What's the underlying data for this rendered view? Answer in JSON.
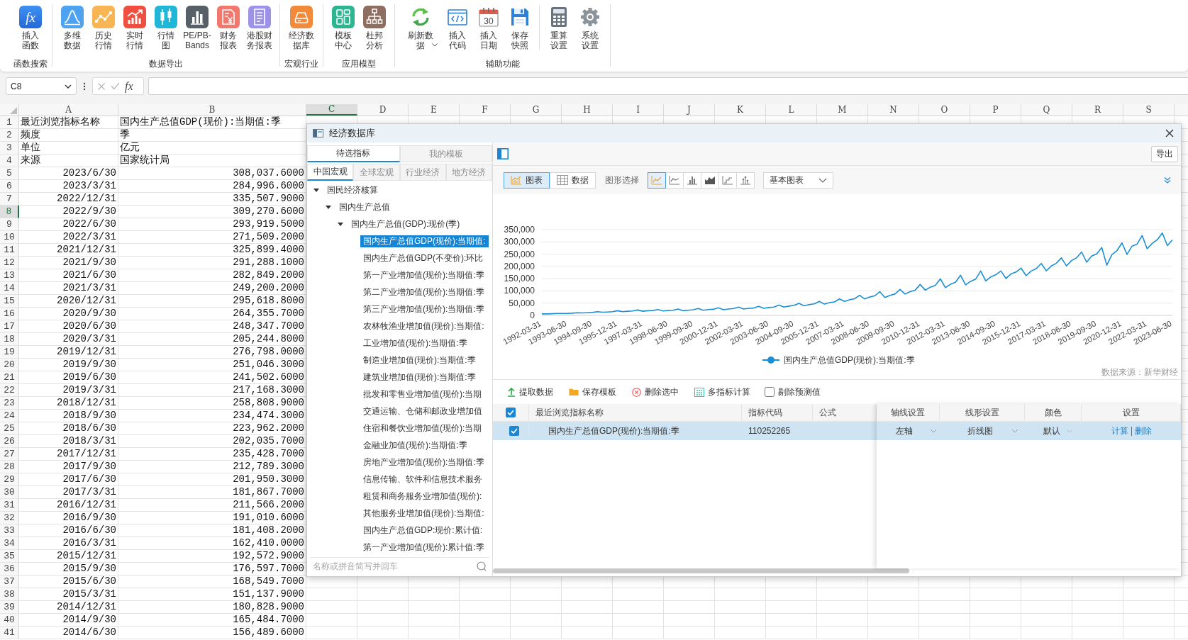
{
  "ribbon": {
    "groups": [
      {
        "label": "函数搜索",
        "sections": [
          [
            {
              "label": "插入函数",
              "glyph": "fx",
              "dropdown": false
            }
          ]
        ]
      },
      {
        "label": "数据导出",
        "sections": [
          [
            {
              "label": "多维数据",
              "dropdown": false
            },
            {
              "label": "历史行情",
              "dropdown": false
            },
            {
              "label": "实时行情",
              "dropdown": false
            },
            {
              "label": "行情图",
              "dropdown": false
            },
            {
              "label": "PE/PB-Bands",
              "dropdown": false
            },
            {
              "label": "财务报表",
              "dropdown": false
            },
            {
              "label": "港股财务报表",
              "dropdown": false
            }
          ]
        ]
      },
      {
        "label": "宏观行业",
        "sections": [
          [
            {
              "label": "经济数据库",
              "dropdown": false
            }
          ]
        ]
      },
      {
        "label": "应用模型",
        "sections": [
          [
            {
              "label": "模板中心",
              "dropdown": false
            },
            {
              "label": "杜邦分析",
              "dropdown": false
            }
          ]
        ]
      },
      {
        "label": "辅助功能",
        "sections": [
          [
            {
              "label": "刷新数据",
              "dropdown": true
            },
            {
              "label": "插入代码",
              "dropdown": false
            },
            {
              "label": "插入日期",
              "glyph": "30",
              "dropdown": false
            },
            {
              "label": "保存快照",
              "dropdown": false
            }
          ],
          [
            {
              "label": "重算设置",
              "dropdown": false
            },
            {
              "label": "系统设置",
              "dropdown": false
            }
          ]
        ]
      }
    ]
  },
  "formula_bar": {
    "name_box": "C8",
    "function_glyph": "fx"
  },
  "sheet": {
    "columns": [
      {
        "label": "A",
        "selected": false
      },
      {
        "label": "B",
        "selected": false
      },
      {
        "label": "C",
        "selected": true
      },
      {
        "label": "D",
        "selected": false
      },
      {
        "label": "E",
        "selected": false
      },
      {
        "label": "F",
        "selected": false
      },
      {
        "label": "G",
        "selected": false
      },
      {
        "label": "H",
        "selected": false
      },
      {
        "label": "I",
        "selected": false
      },
      {
        "label": "J",
        "selected": false
      },
      {
        "label": "K",
        "selected": false
      },
      {
        "label": "L",
        "selected": false
      },
      {
        "label": "M",
        "selected": false
      },
      {
        "label": "N",
        "selected": false
      },
      {
        "label": "O",
        "selected": false
      },
      {
        "label": "P",
        "selected": false
      },
      {
        "label": "Q",
        "selected": false
      },
      {
        "label": "R",
        "selected": false
      },
      {
        "label": "S",
        "selected": false
      }
    ],
    "rows": [
      {
        "header": "1",
        "selected": false,
        "kind": "label",
        "cells": [
          "最近浏览指标名称",
          "国内生产总值GDP(现价):当期值:季"
        ]
      },
      {
        "header": "2",
        "selected": false,
        "kind": "label",
        "cells": [
          "频度",
          "季"
        ]
      },
      {
        "header": "3",
        "selected": false,
        "kind": "label",
        "cells": [
          "单位",
          "亿元"
        ]
      },
      {
        "header": "4",
        "selected": false,
        "kind": "label",
        "cells": [
          "来源",
          "国家统计局"
        ]
      },
      {
        "header": "5",
        "selected": false,
        "kind": "value",
        "cells": [
          "2023/6/30",
          "308,037.6000"
        ]
      },
      {
        "header": "6",
        "selected": false,
        "kind": "value",
        "cells": [
          "2023/3/31",
          "284,996.6000"
        ]
      },
      {
        "header": "7",
        "selected": false,
        "kind": "value",
        "cells": [
          "2022/12/31",
          "335,507.9000"
        ]
      },
      {
        "header": "8",
        "selected": true,
        "kind": "value",
        "cells": [
          "2022/9/30",
          "309,270.6000"
        ]
      },
      {
        "header": "9",
        "selected": false,
        "kind": "value",
        "cells": [
          "2022/6/30",
          "293,919.5000"
        ]
      },
      {
        "header": "10",
        "selected": false,
        "kind": "value",
        "cells": [
          "2022/3/31",
          "271,509.2000"
        ]
      },
      {
        "header": "11",
        "selected": false,
        "kind": "value",
        "cells": [
          "2021/12/31",
          "325,899.4000"
        ]
      },
      {
        "header": "12",
        "selected": false,
        "kind": "value",
        "cells": [
          "2021/9/30",
          "291,288.1000"
        ]
      },
      {
        "header": "13",
        "selected": false,
        "kind": "value",
        "cells": [
          "2021/6/30",
          "282,849.2000"
        ]
      },
      {
        "header": "14",
        "selected": false,
        "kind": "value",
        "cells": [
          "2021/3/31",
          "249,200.2000"
        ]
      },
      {
        "header": "15",
        "selected": false,
        "kind": "value",
        "cells": [
          "2020/12/31",
          "295,618.8000"
        ]
      },
      {
        "header": "16",
        "selected": false,
        "kind": "value",
        "cells": [
          "2020/9/30",
          "264,355.7000"
        ]
      },
      {
        "header": "17",
        "selected": false,
        "kind": "value",
        "cells": [
          "2020/6/30",
          "248,347.7000"
        ]
      },
      {
        "header": "18",
        "selected": false,
        "kind": "value",
        "cells": [
          "2020/3/31",
          "205,244.8000"
        ]
      },
      {
        "header": "19",
        "selected": false,
        "kind": "value",
        "cells": [
          "2019/12/31",
          "276,798.0000"
        ]
      },
      {
        "header": "20",
        "selected": false,
        "kind": "value",
        "cells": [
          "2019/9/30",
          "251,046.3000"
        ]
      },
      {
        "header": "21",
        "selected": false,
        "kind": "value",
        "cells": [
          "2019/6/30",
          "241,502.6000"
        ]
      },
      {
        "header": "22",
        "selected": false,
        "kind": "value",
        "cells": [
          "2019/3/31",
          "217,168.3000"
        ]
      },
      {
        "header": "23",
        "selected": false,
        "kind": "value",
        "cells": [
          "2018/12/31",
          "258,808.9000"
        ]
      },
      {
        "header": "24",
        "selected": false,
        "kind": "value",
        "cells": [
          "2018/9/30",
          "234,474.3000"
        ]
      },
      {
        "header": "25",
        "selected": false,
        "kind": "value",
        "cells": [
          "2018/6/30",
          "223,962.2000"
        ]
      },
      {
        "header": "26",
        "selected": false,
        "kind": "value",
        "cells": [
          "2018/3/31",
          "202,035.7000"
        ]
      },
      {
        "header": "27",
        "selected": false,
        "kind": "value",
        "cells": [
          "2017/12/31",
          "235,428.7000"
        ]
      },
      {
        "header": "28",
        "selected": false,
        "kind": "value",
        "cells": [
          "2017/9/30",
          "212,789.3000"
        ]
      },
      {
        "header": "29",
        "selected": false,
        "kind": "value",
        "cells": [
          "2017/6/30",
          "201,950.3000"
        ]
      },
      {
        "header": "30",
        "selected": false,
        "kind": "value",
        "cells": [
          "2017/3/31",
          "181,867.7000"
        ]
      },
      {
        "header": "31",
        "selected": false,
        "kind": "value",
        "cells": [
          "2016/12/31",
          "211,566.2000"
        ]
      },
      {
        "header": "32",
        "selected": false,
        "kind": "value",
        "cells": [
          "2016/9/30",
          "191,010.6000"
        ]
      },
      {
        "header": "33",
        "selected": false,
        "kind": "value",
        "cells": [
          "2016/6/30",
          "181,408.2000"
        ]
      },
      {
        "header": "34",
        "selected": false,
        "kind": "value",
        "cells": [
          "2016/3/31",
          "162,410.0000"
        ]
      },
      {
        "header": "35",
        "selected": false,
        "kind": "value",
        "cells": [
          "2015/12/31",
          "192,572.9000"
        ]
      },
      {
        "header": "36",
        "selected": false,
        "kind": "value",
        "cells": [
          "2015/9/30",
          "176,597.7000"
        ]
      },
      {
        "header": "37",
        "selected": false,
        "kind": "value",
        "cells": [
          "2015/6/30",
          "168,549.7000"
        ]
      },
      {
        "header": "38",
        "selected": false,
        "kind": "value",
        "cells": [
          "2015/3/31",
          "151,137.9000"
        ]
      },
      {
        "header": "39",
        "selected": false,
        "kind": "value",
        "cells": [
          "2014/12/31",
          "180,828.9000"
        ]
      },
      {
        "header": "40",
        "selected": false,
        "kind": "value",
        "cells": [
          "2014/9/30",
          "165,484.7000"
        ]
      },
      {
        "header": "41",
        "selected": false,
        "kind": "value",
        "cells": [
          "2014/6/30",
          "156,489.6000"
        ]
      }
    ]
  },
  "dialog": {
    "title": "经济数据库",
    "panel_tabs": [
      {
        "label": "待选指标",
        "selected": true
      },
      {
        "label": "我的模板",
        "selected": false
      }
    ],
    "category_tabs": [
      {
        "label": "中国宏观",
        "selected": true
      },
      {
        "label": "全球宏观",
        "selected": false
      },
      {
        "label": "行业经济",
        "selected": false
      },
      {
        "label": "地方经济",
        "selected": false
      }
    ],
    "tree": [
      {
        "label": "国民经济核算",
        "expanded": true,
        "selected": false,
        "children": [
          {
            "label": "国内生产总值",
            "expanded": true,
            "selected": false,
            "children": [
              {
                "label": "国内生产总值(GDP):现价(季)",
                "expanded": true,
                "selected": false,
                "children": [
                  {
                    "label": "国内生产总值GDP(现价):当期值:",
                    "selected": true
                  },
                  {
                    "label": "国内生产总值GDP(不变价):环比",
                    "selected": false
                  },
                  {
                    "label": "第一产业增加值(现价):当期值:季",
                    "selected": false
                  },
                  {
                    "label": "第二产业增加值(现价):当期值:季",
                    "selected": false
                  },
                  {
                    "label": "第三产业增加值(现价):当期值:季",
                    "selected": false
                  },
                  {
                    "label": "农林牧渔业增加值(现价):当期值:",
                    "selected": false
                  },
                  {
                    "label": "工业增加值(现价):当期值:季",
                    "selected": false
                  },
                  {
                    "label": "制造业增加值(现价):当期值:季",
                    "selected": false
                  },
                  {
                    "label": "建筑业增加值(现价):当期值:季",
                    "selected": false
                  },
                  {
                    "label": "批发和零售业增加值(现价):当期",
                    "selected": false
                  },
                  {
                    "label": "交通运输、仓储和邮政业增加值",
                    "selected": false
                  },
                  {
                    "label": "住宿和餐饮业增加值(现价):当期",
                    "selected": false
                  },
                  {
                    "label": "金融业加值(现价):当期值:季",
                    "selected": false
                  },
                  {
                    "label": "房地产业增加值(现价):当期值:季",
                    "selected": false
                  },
                  {
                    "label": "信息传输、软件和信息技术服务",
                    "selected": false
                  },
                  {
                    "label": "租赁和商务服务业增加值(现价):",
                    "selected": false
                  },
                  {
                    "label": "其他服务业增加值(现价):当期值:",
                    "selected": false
                  },
                  {
                    "label": "国内生产总值GDP:现价:累计值:",
                    "selected": false
                  },
                  {
                    "label": "第一产业增加值(现价):累计值:季",
                    "selected": false
                  }
                ]
              }
            ]
          }
        ]
      }
    ],
    "search": {
      "placeholder": "名称或拼音简写并回车"
    },
    "export_button": "导出",
    "view_tabs": [
      {
        "label": "图表",
        "selected": true
      },
      {
        "label": "数据",
        "selected": false
      }
    ],
    "chart_type_label": "图形选择",
    "chart_types": [
      {
        "selected": true
      },
      {
        "selected": false
      },
      {
        "selected": false
      },
      {
        "selected": false
      },
      {
        "selected": false
      },
      {
        "selected": false
      }
    ],
    "chart_style_select": {
      "value": "基本图表"
    },
    "chart": {
      "chart_data": {
        "type": "line",
        "categories": [
          "1992-03-31",
          null,
          null,
          null,
          null,
          "1993-06-30",
          null,
          null,
          null,
          null,
          "1994-09-30",
          null,
          null,
          null,
          null,
          "1995-12-31",
          null,
          null,
          null,
          null,
          "1997-03-31",
          null,
          null,
          null,
          null,
          "1998-06-30",
          null,
          null,
          null,
          null,
          "1999-09-30",
          null,
          null,
          null,
          null,
          "2000-12-31",
          null,
          null,
          null,
          null,
          "2002-03-31",
          null,
          null,
          null,
          null,
          "2003-06-30",
          null,
          null,
          null,
          null,
          "2004-09-30",
          null,
          null,
          null,
          null,
          "2005-12-31",
          null,
          null,
          null,
          null,
          "2007-03-31",
          null,
          null,
          null,
          null,
          "2008-06-30",
          null,
          null,
          null,
          null,
          "2009-09-30",
          null,
          null,
          null,
          null,
          "2010-12-31",
          null,
          null,
          null,
          null,
          "2012-03-31",
          null,
          null,
          null,
          null,
          "2013-06-30",
          null,
          null,
          null,
          null,
          "2014-09-30",
          null,
          null,
          null,
          null,
          "2015-12-31",
          null,
          null,
          null,
          null,
          "2017-03-31",
          null,
          null,
          null,
          null,
          "2018-06-30",
          null,
          null,
          null,
          null,
          "2019-09-30",
          null,
          null,
          null,
          null,
          "2020-12-31",
          null,
          null,
          null,
          null,
          "2022-03-31",
          null,
          null,
          null,
          null,
          "2023-06-30"
        ],
        "series": [
          {
            "name": "国内生产总值GDP(现价):当期值:季",
            "color": "#1a8fd6",
            "values": [
              6000,
              6000,
              7000,
              8000,
              8000,
              8000,
              9000,
              11000,
              10000,
              11000,
              12000,
              15000,
              13000,
              14000,
              15000,
              19000,
              15000,
              17000,
              18000,
              22000,
              17000,
              19000,
              20000,
              24000,
              18000,
              20000,
              21000,
              26000,
              19000,
              21000,
              23000,
              28000,
              21000,
              24000,
              25000,
              31000,
              23000,
              26000,
              28000,
              34000,
              26000,
              29000,
              30000,
              37000,
              29000,
              32000,
              34000,
              42000,
              34000,
              38000,
              41000,
              49000,
              39000,
              44000,
              47000,
              57000,
              46000,
              52000,
              55000,
              67000,
              57000,
              64000,
              68000,
              82000,
              67000,
              75000,
              80000,
              97000,
              73000,
              82000,
              87000,
              106000,
              87000,
              97000,
              103000,
              126000,
              103000,
              115000,
              122000,
              149000,
              113000,
              127000,
              135000,
              164000,
              125000,
              139000,
              148000,
              181000,
              141000,
              157000,
              166000,
              181000,
              151000,
              169000,
              177000,
              193000,
              162000,
              181000,
              191000,
              212000,
              182000,
              202000,
              213000,
              235000,
              202000,
              224000,
              235000,
              259000,
              217000,
              242000,
              251000,
              277000,
              205000,
              248000,
              264000,
              296000,
              249000,
              283000,
              291000,
              326000,
              272000,
              294000,
              309000,
              336000,
              285000,
              308000
            ]
          }
        ],
        "ylim": [
          0,
          350000
        ],
        "yticks": [
          {
            "value": 0,
            "label": "0"
          },
          {
            "value": 50000,
            "label": "50,000"
          },
          {
            "value": 100000,
            "label": "100,000"
          },
          {
            "value": 150000,
            "label": "150,000"
          },
          {
            "value": 200000,
            "label": "200,000"
          },
          {
            "value": 250000,
            "label": "250,000"
          },
          {
            "value": 300000,
            "label": "300,000"
          },
          {
            "value": 350000,
            "label": "350,000"
          }
        ],
        "grid": true
      },
      "source": "数据来源：新华财经"
    },
    "actions": [
      "提取数据",
      "保存模板",
      "删除选中",
      "多指标计算"
    ],
    "exclude_forecast": {
      "label": "剔除预测值",
      "checked": false
    },
    "table": {
      "select_all": {
        "checked": true
      },
      "columns": [
        "最近浏览指标名称",
        "指标代码",
        "公式",
        "轴线设置",
        "线形设置",
        "颜色",
        "设置"
      ],
      "rows": [
        {
          "checked": true,
          "selected": true,
          "name": "国内生产总值GDP(现价):当期值:季",
          "code": "110252265",
          "axis": "左轴",
          "line_type": "折线图",
          "color_setting": "默认",
          "actions": [
            "计算",
            "删除"
          ]
        }
      ]
    }
  }
}
